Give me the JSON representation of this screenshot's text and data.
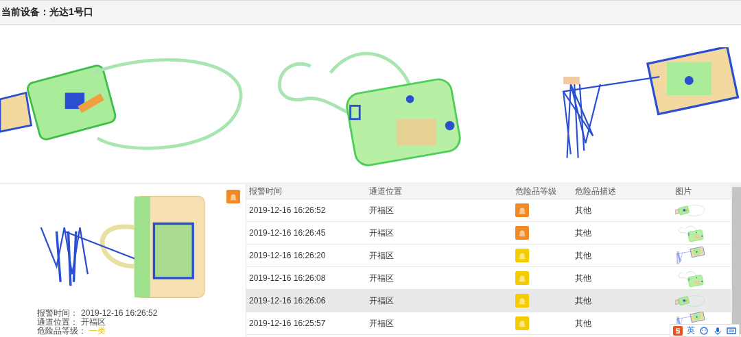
{
  "header": {
    "title": "当前设备：光达1号口"
  },
  "detail": {
    "alarm": {
      "color": "#f08a24"
    },
    "fields": [
      {
        "label": "报警时间：",
        "value": "2019-12-16 16:26:52"
      },
      {
        "label": "通道位置：",
        "value": "开福区"
      },
      {
        "label": "危险品等级：",
        "value": "一类",
        "kind": "level"
      }
    ]
  },
  "table": {
    "columns": [
      "报警时间",
      "通道位置",
      "危险品等级",
      "危险品描述",
      "图片"
    ],
    "rows": [
      {
        "time": "2019-12-16 16:26:52",
        "location": "开福区",
        "color": "#f08a24",
        "description": "其他",
        "selected": false
      },
      {
        "time": "2019-12-16 16:26:45",
        "location": "开福区",
        "color": "#f08a24",
        "description": "其他",
        "selected": false
      },
      {
        "time": "2019-12-16 16:26:20",
        "location": "开福区",
        "color": "#f5cc00",
        "description": "其他",
        "selected": false
      },
      {
        "time": "2019-12-16 16:26:08",
        "location": "开福区",
        "color": "#f5cc00",
        "description": "其他",
        "selected": false
      },
      {
        "time": "2019-12-16 16:26:06",
        "location": "开福区",
        "color": "#f5cc00",
        "description": "其他",
        "selected": true
      },
      {
        "time": "2019-12-16 16:25:57",
        "location": "开福区",
        "color": "#f5cc00",
        "description": "其他",
        "selected": false
      }
    ]
  },
  "ime_bar": {
    "mode": "英"
  }
}
